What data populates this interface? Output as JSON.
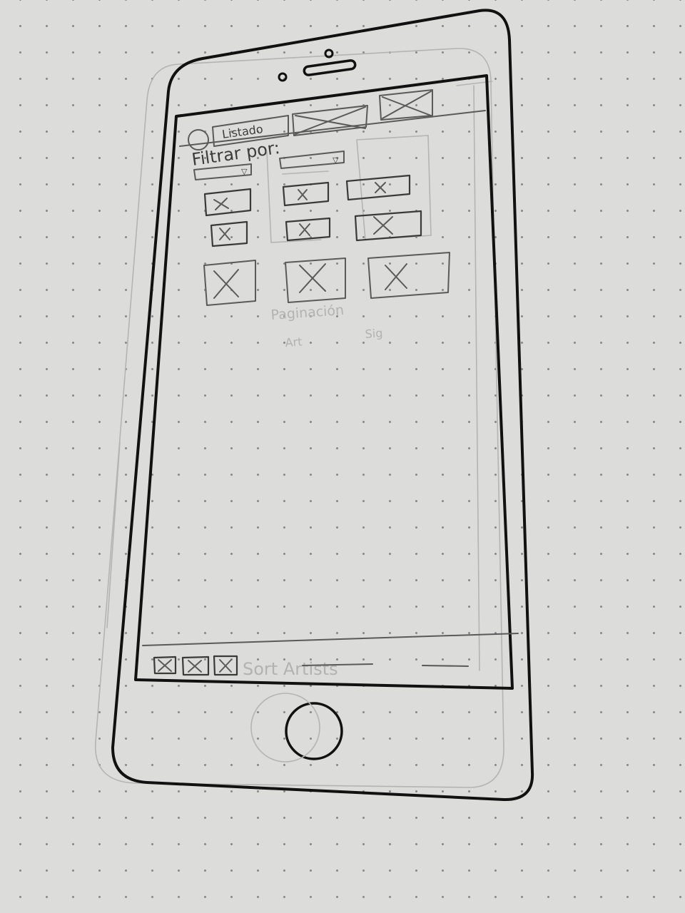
{
  "screen": {
    "tab_label": "Listado",
    "filter_label": "Filtrar por:",
    "dropdown_glyph": "▽",
    "pagination_text": "Paginación",
    "footer_text": "Sort Artists",
    "faint_left": "Art",
    "faint_right": "Sig"
  },
  "icons": {
    "placeholder": "image-placeholder-icon",
    "home_button": "home-button-icon",
    "camera": "camera-icon",
    "speaker": "speaker-icon"
  }
}
